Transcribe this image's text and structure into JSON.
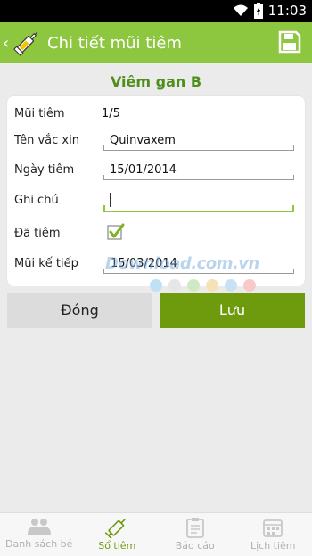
{
  "status": {
    "time": "11:03"
  },
  "header": {
    "title": "Chi tiết mũi tiêm"
  },
  "vaccine_name": "Viêm gan B",
  "form": {
    "dose_label": "Mũi tiêm",
    "dose_value": "1/5",
    "vaccine_label": "Tên vắc xin",
    "vaccine_value": "Quinvaxem",
    "date_label": "Ngày tiêm",
    "date_value": "15/01/2014",
    "note_label": "Ghi chú",
    "note_value": "",
    "done_label": "Đã tiêm",
    "done_checked": true,
    "next_label": "Mũi kế tiếp",
    "next_value": "15/03/2014"
  },
  "watermark": "Download.com.vn",
  "buttons": {
    "close": "Đóng",
    "save": "Lưu"
  },
  "nav": [
    {
      "label": "Danh sách bé",
      "icon": "people-icon"
    },
    {
      "label": "Sổ tiêm",
      "icon": "syringe-icon",
      "active": true
    },
    {
      "label": "Báo cáo",
      "icon": "clipboard-icon"
    },
    {
      "label": "Lịch tiêm",
      "icon": "calendar-icon"
    }
  ],
  "colors": {
    "accent": "#8dc63f",
    "primary_button": "#6e9b0d",
    "heading": "#4e8f1b"
  }
}
